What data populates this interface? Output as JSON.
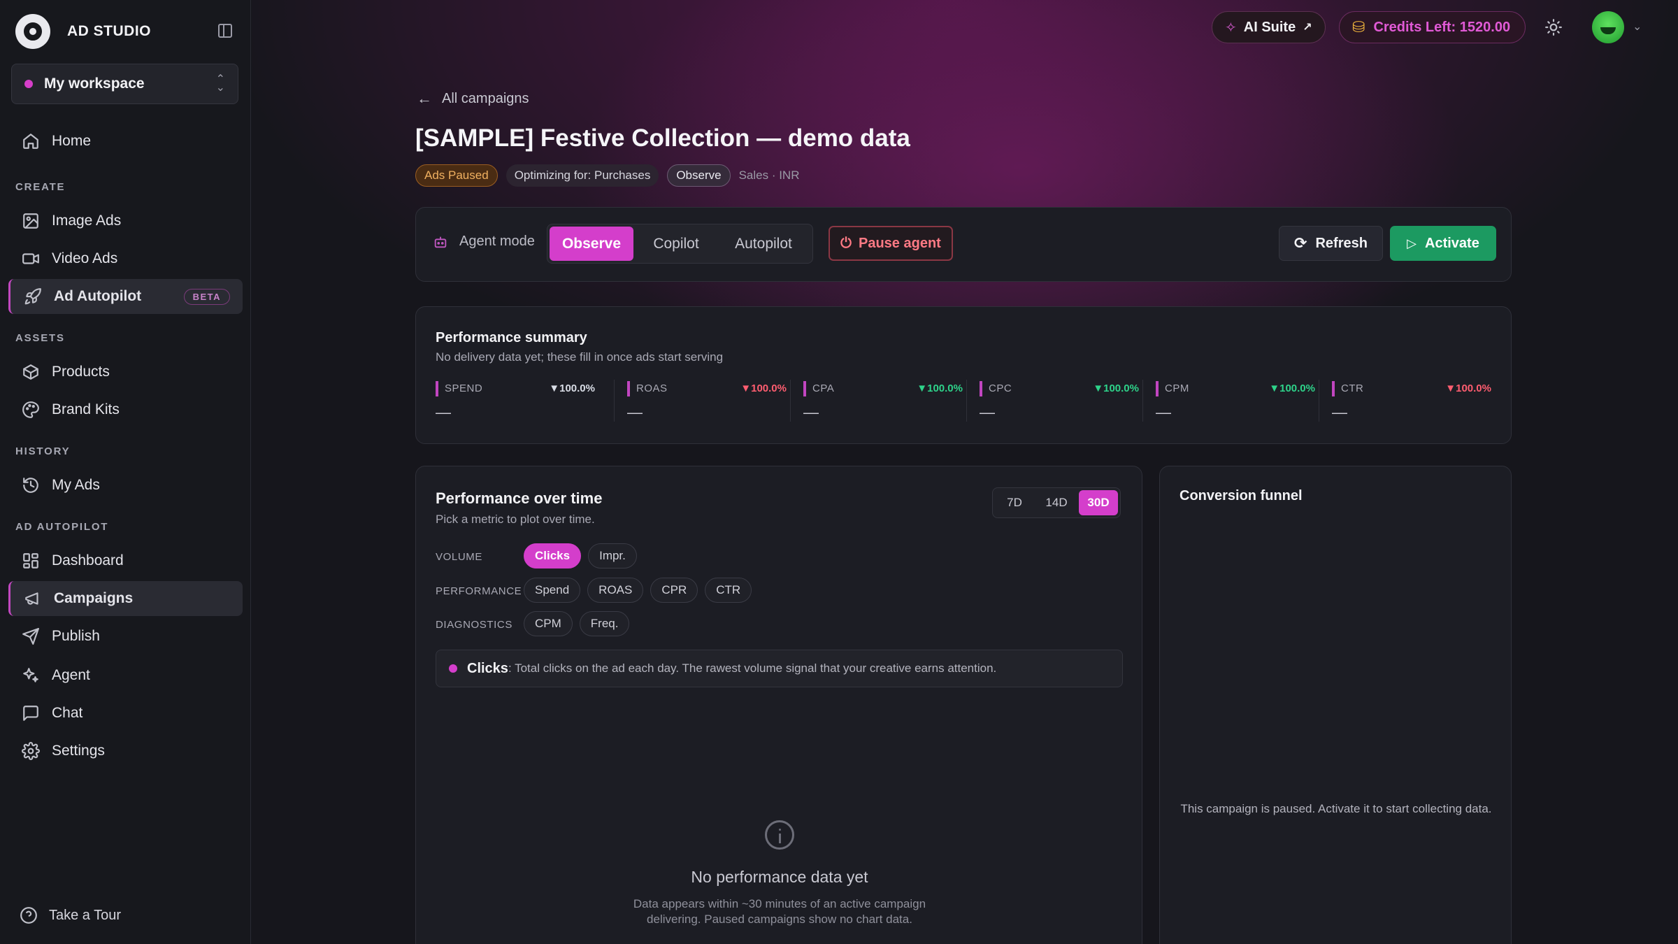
{
  "brand": {
    "name": "AD STUDIO"
  },
  "workspace": {
    "label": "My workspace"
  },
  "sidebar": {
    "home": "Home",
    "sections": {
      "create": "CREATE",
      "assets": "ASSETS",
      "history": "HISTORY",
      "autopilot": "AD AUTOPILOT"
    },
    "items": {
      "image_ads": "Image Ads",
      "video_ads": "Video Ads",
      "ad_autopilot": "Ad Autopilot",
      "beta": "BETA",
      "products": "Products",
      "brand_kits": "Brand Kits",
      "my_ads": "My Ads",
      "dashboard": "Dashboard",
      "campaigns": "Campaigns",
      "publish": "Publish",
      "agent": "Agent",
      "chat": "Chat",
      "settings": "Settings"
    },
    "tour": "Take a Tour"
  },
  "topbar": {
    "ai_suite": "AI Suite",
    "credits": "Credits Left: 1520.00"
  },
  "header": {
    "back": "All campaigns",
    "title": "[SAMPLE] Festive Collection — demo data",
    "tags": {
      "status": "Ads Paused",
      "optimizing": "Optimizing for: Purchases",
      "mode": "Observe",
      "meta": "Sales · INR"
    }
  },
  "agent": {
    "label": "Agent mode",
    "modes": [
      "Observe",
      "Copilot",
      "Autopilot"
    ],
    "active_mode": "Observe",
    "pause": "Pause agent",
    "refresh": "Refresh",
    "activate": "Activate"
  },
  "summary": {
    "title": "Performance summary",
    "subtitle": "No delivery data yet; these fill in once ads start serving",
    "metrics": [
      {
        "name": "SPEND",
        "delta": "▼100.0%",
        "value": "—"
      },
      {
        "name": "ROAS",
        "delta": "▼100.0%",
        "value": "—"
      },
      {
        "name": "CPA",
        "delta": "▼100.0%",
        "value": "—"
      },
      {
        "name": "CPC",
        "delta": "▼100.0%",
        "value": "—"
      },
      {
        "name": "CPM",
        "delta": "▼100.0%",
        "value": "—"
      },
      {
        "name": "CTR",
        "delta": "▼100.0%",
        "value": "—"
      }
    ],
    "colors": {
      "neutral": "#d9dde6",
      "bad": "#ff5d70",
      "good": "#2ed38a"
    }
  },
  "over_time": {
    "title": "Performance over time",
    "subtitle": "Pick a metric to plot over time.",
    "ranges": [
      "7D",
      "14D",
      "30D"
    ],
    "active_range": "30D",
    "rows": {
      "volume": {
        "label": "VOLUME",
        "chips": [
          "Clicks",
          "Impr."
        ]
      },
      "performance": {
        "label": "PERFORMANCE",
        "chips": [
          "Spend",
          "ROAS",
          "CPR",
          "CTR"
        ]
      },
      "diagnostics": {
        "label": "DIAGNOSTICS",
        "chips": [
          "CPM",
          "Freq."
        ]
      }
    },
    "active_chip": "Clicks",
    "description": {
      "metric": "Clicks",
      "text": ": Total clicks on the ad each day. The rawest volume signal that your creative earns attention."
    },
    "empty": {
      "title": "No performance data yet",
      "line1": "Data appears within ~30 minutes of an active campaign",
      "line2": "delivering. Paused campaigns show no chart data."
    }
  },
  "funnel": {
    "title": "Conversion funnel",
    "message": "This campaign is paused. Activate it to start collecting data."
  },
  "accent": "#d43ecb"
}
